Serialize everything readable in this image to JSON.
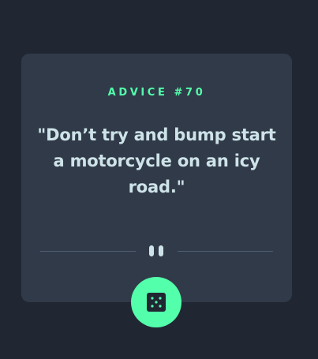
{
  "advice": {
    "label": "ADVICE #70",
    "quote": "\"Don’t try and bump start a motorcycle on an icy road.\""
  },
  "icons": {
    "divider": "pause-icon",
    "button": "dice-icon"
  },
  "colors": {
    "background": "#202733",
    "card": "#313a48",
    "accent": "#53ffab",
    "text": "#cee3e9",
    "divider": "#4f5d74"
  }
}
